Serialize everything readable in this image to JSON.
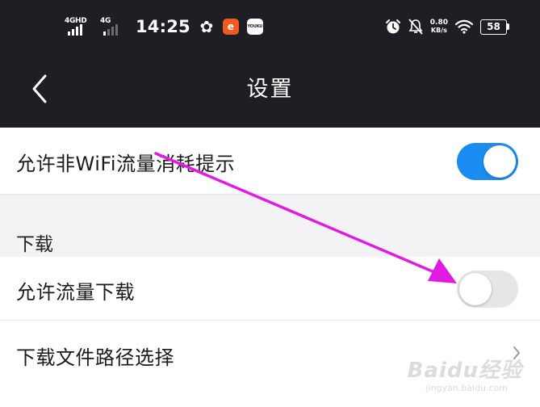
{
  "status_bar": {
    "network_1": "4GHD",
    "network_2": "4G",
    "time": "14:25",
    "app_icon_1": "fan-icon",
    "app_icon_2": "orange-app-icon",
    "app_icon_3_label": "YOUKU",
    "speed_value": "0.80",
    "speed_unit": "KB/s",
    "battery": "58"
  },
  "nav": {
    "title": "设置",
    "back_icon": "chevron-left-icon"
  },
  "settings": {
    "wifi_prompt": {
      "label": "允许非WiFi流量消耗提示",
      "enabled": true
    },
    "download_section": {
      "title": "下载"
    },
    "allow_data_download": {
      "label": "允许流量下载",
      "enabled": false
    },
    "download_path": {
      "label": "下载文件路径选择"
    }
  },
  "watermark": {
    "main": "Baidu经验",
    "sub": "jingyan.baidu.com"
  },
  "colors": {
    "header_bg": "#1e1f24",
    "toggle_on": "#1b8cf2",
    "toggle_off": "#e6e6e6",
    "annotation_arrow": "#e11be3",
    "section_bg": "#f3f3f5"
  }
}
